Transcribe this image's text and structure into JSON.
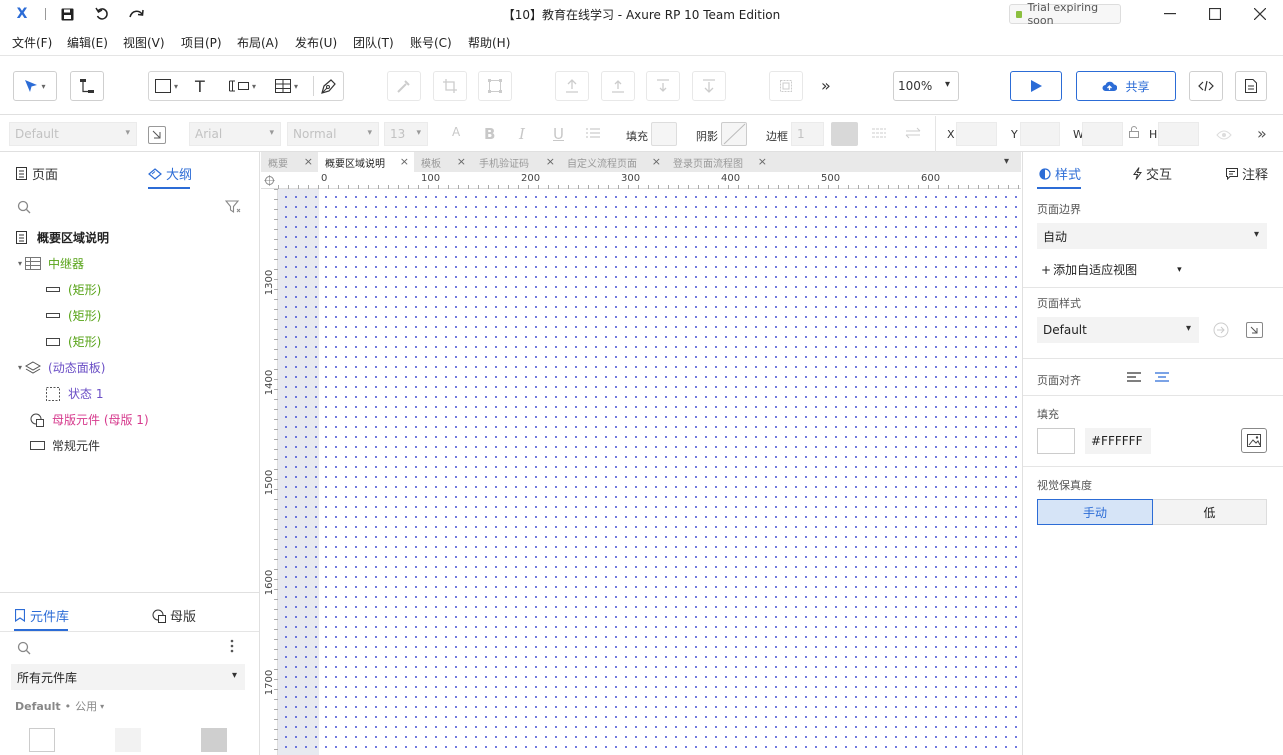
{
  "title_bar": {
    "app_logo": "X",
    "window_title": "【10】教育在线学习 - Axure RP 10 Team Edition",
    "trial_text": "Trial expiring soon"
  },
  "menu": [
    "文件(F)",
    "编辑(E)",
    "视图(V)",
    "项目(P)",
    "布局(A)",
    "发布(U)",
    "团队(T)",
    "账号(C)",
    "帮助(H)"
  ],
  "toolbar": {
    "zoom": "100%",
    "share_label": "共享",
    "more": "»"
  },
  "style_bar": {
    "style_value": "Default",
    "font_family": "Arial",
    "font_weight": "Normal",
    "font_size": "13",
    "fill_label": "填充",
    "shadow_label": "阴影",
    "border_label": "边框",
    "border_value": "1",
    "x_label": "X",
    "y_label": "Y",
    "w_label": "W",
    "h_label": "H"
  },
  "left_panel": {
    "tabs": [
      "页面",
      "大纲"
    ],
    "outline": [
      {
        "label": "概要区域说明",
        "level": 0,
        "type": "page"
      },
      {
        "label": "中继器",
        "level": 1,
        "type": "repeater"
      },
      {
        "label": "(矩形)",
        "level": 2,
        "type": "rect"
      },
      {
        "label": "(矩形)",
        "level": 2,
        "type": "rect"
      },
      {
        "label": "(矩形)",
        "level": 2,
        "type": "rect"
      },
      {
        "label": "(动态面板)",
        "level": 1,
        "type": "panel"
      },
      {
        "label": "状态 1",
        "level": 2,
        "type": "state"
      },
      {
        "label": "母版元件 (母版 1)",
        "level": 1,
        "type": "master"
      },
      {
        "label": "常规元件",
        "level": 1,
        "type": "widget"
      }
    ],
    "bottom_tabs": [
      "元件库",
      "母版"
    ],
    "library_select": "所有元件库",
    "library_group": "Default",
    "library_group_sub": "公用"
  },
  "doc_tabs": [
    {
      "label": "概要",
      "active": false
    },
    {
      "label": "概要区域说明",
      "active": true
    },
    {
      "label": "模板",
      "active": false
    },
    {
      "label": "手机验证码",
      "active": false
    },
    {
      "label": "自定义流程页面",
      "active": false
    },
    {
      "label": "登录页面流程图",
      "active": false
    }
  ],
  "rulers": {
    "h_ticks": [
      "0",
      "100",
      "200",
      "300",
      "400",
      "500",
      "600"
    ],
    "v_ticks": [
      "1300",
      "1400",
      "1500",
      "1600",
      "1700"
    ]
  },
  "right_panel": {
    "tabs": [
      "样式",
      "交互",
      "注释"
    ],
    "page_dimension_label": "页面边界",
    "page_dimension_value": "自动",
    "add_adaptive": "添加自适应视图",
    "page_style_label": "页面样式",
    "page_style_value": "Default",
    "page_align_label": "页面对齐",
    "fill_label": "填充",
    "fill_hex": "#FFFFFF",
    "fidelity_label": "视觉保真度",
    "fidelity_options": [
      "手动",
      "低"
    ]
  },
  "colors": {
    "accent": "#2c6cd6",
    "green": "#57a317",
    "purple": "#6b4fc6",
    "pink": "#d63a8d"
  }
}
